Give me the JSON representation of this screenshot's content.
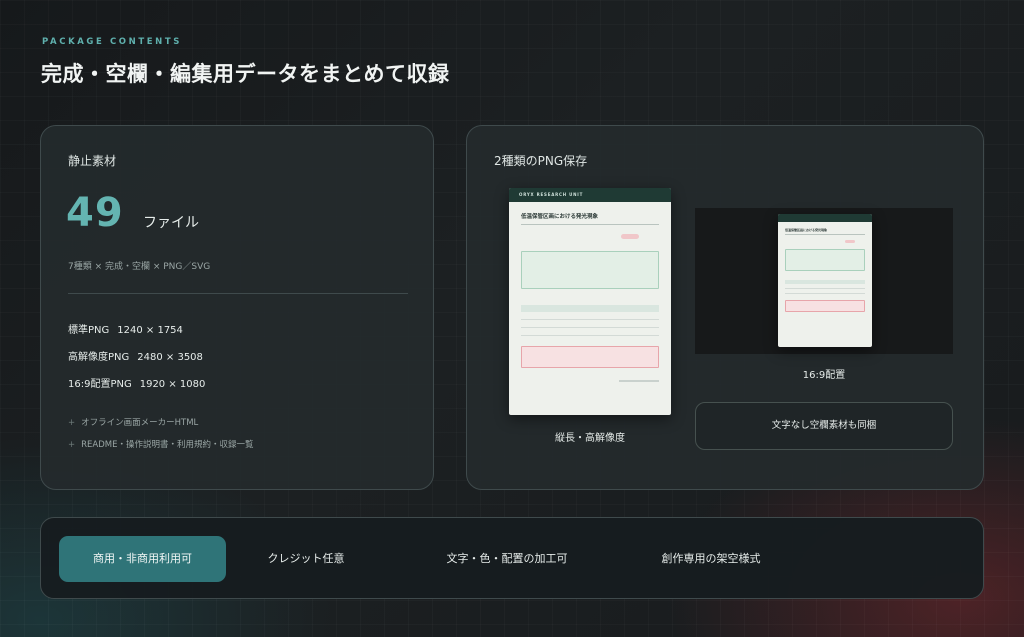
{
  "header": {
    "eyebrow": "PACKAGE CONTENTS",
    "title": "完成・空欄・編集用データをまとめて収録"
  },
  "static_card": {
    "title": "静止素材",
    "count": "49",
    "count_unit": "ファイル",
    "spec": "7種類 × 完成・空欄 × PNG／SVG",
    "resolutions": [
      {
        "label": "標準PNG",
        "value": "1240 × 1754"
      },
      {
        "label": "高解像度PNG",
        "value": "2480 × 3508"
      },
      {
        "label": "16:9配置PNG",
        "value": "1920 × 1080"
      }
    ],
    "extras": [
      "オフライン画面メーカーHTML",
      "README・操作説明書・利用規約・収録一覧"
    ]
  },
  "png_card": {
    "title": "2種類のPNG保存",
    "preview_header": "ORYX RESEARCH UNIT",
    "preview_title": "低温保管区画における発光現象",
    "portrait_caption": "縦長・高解像度",
    "landscape_caption": "16:9配置",
    "blank_button": "文字なし空欄素材も同梱"
  },
  "features": [
    {
      "label": "商用・非商用利用可",
      "active": true
    },
    {
      "label": "クレジット任意",
      "active": false
    },
    {
      "label": "文字・色・配置の加工可",
      "active": false
    },
    {
      "label": "創作専用の架空様式",
      "active": false
    }
  ],
  "colors": {
    "accent": "#64b4b1",
    "active_feature": "#2f7478",
    "warning_box": "#f7e1e2",
    "info_box": "#e3efe6"
  }
}
